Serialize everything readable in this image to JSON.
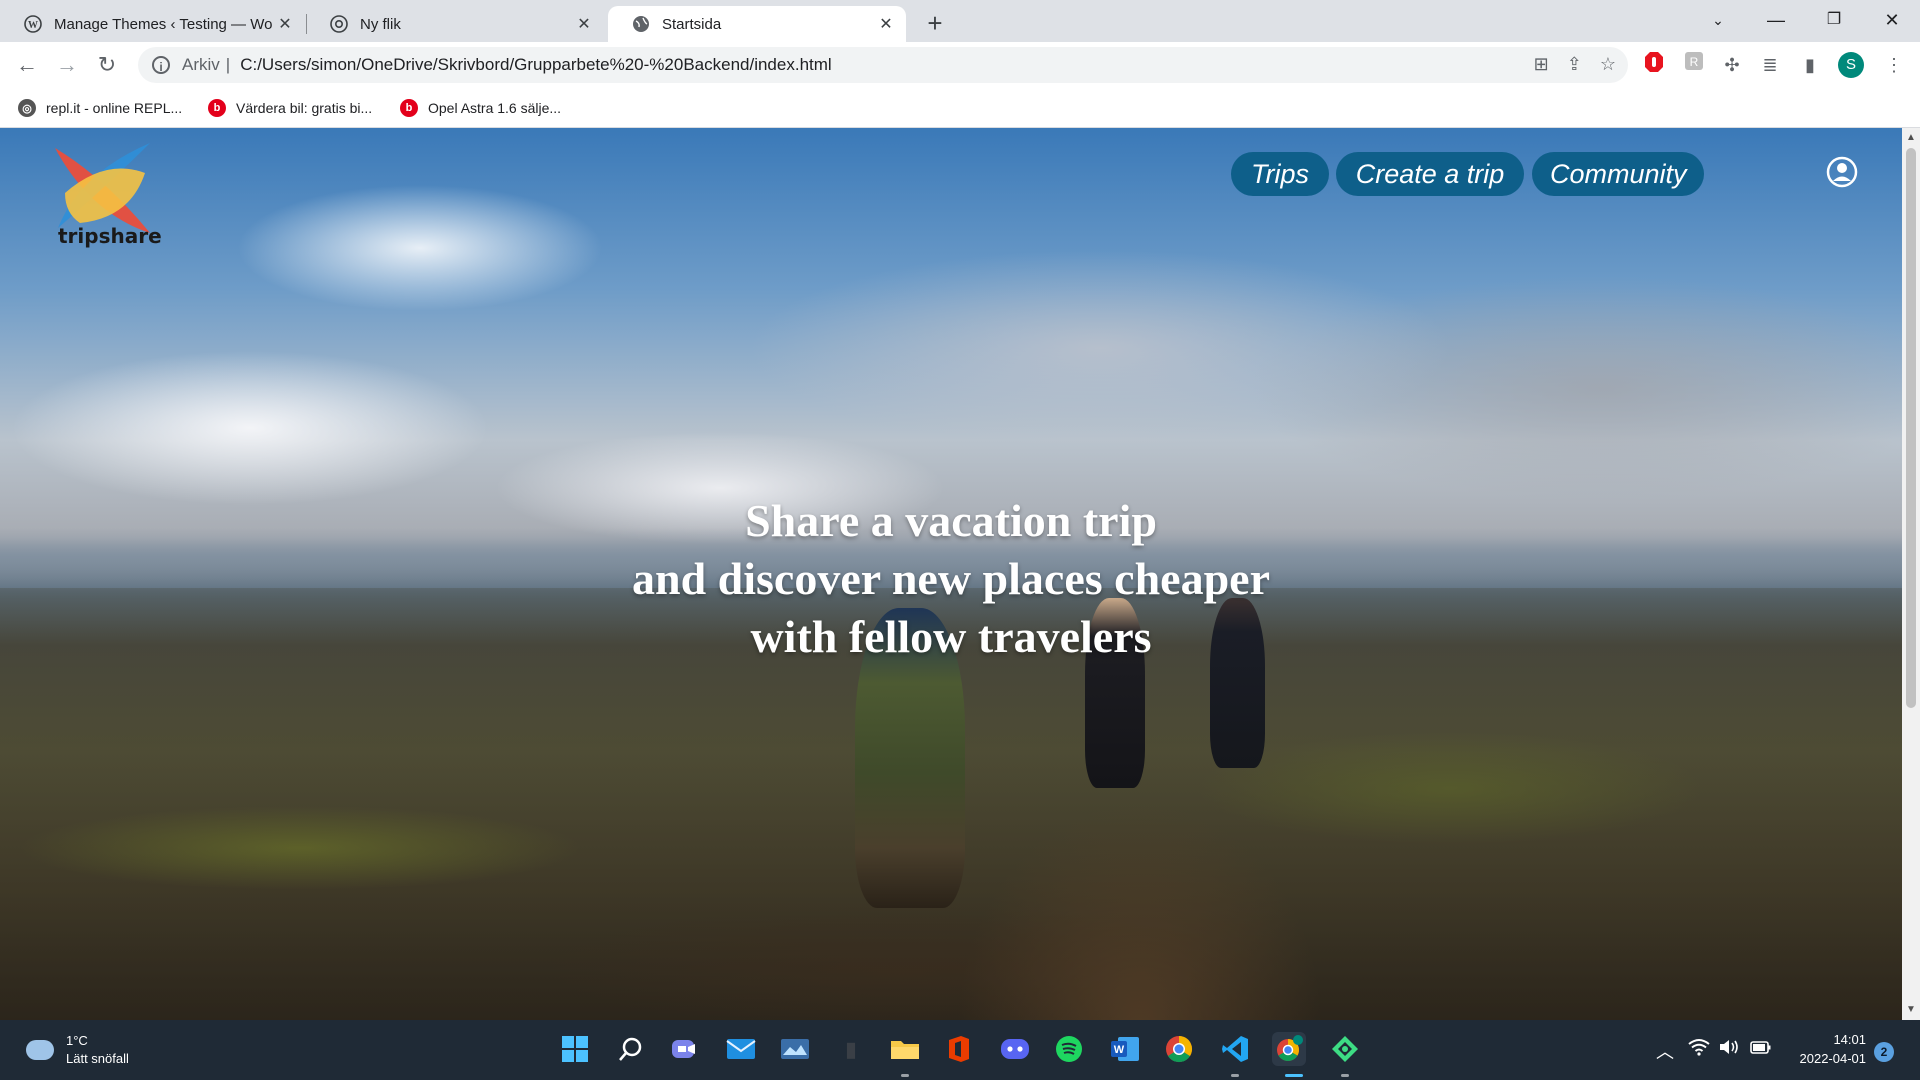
{
  "browser": {
    "tabs": [
      {
        "title": "Manage Themes ‹ Testing — Wo",
        "favicon": "wordpress-icon",
        "active": false
      },
      {
        "title": "Ny flik",
        "favicon": "chrome-icon",
        "active": false
      },
      {
        "title": "Startsida",
        "favicon": "globe-icon",
        "active": true
      }
    ],
    "address_prefix": "Arkiv",
    "address": "C:/Users/simon/OneDrive/Skrivbord/Grupparbete%20-%20Backend/index.html",
    "profile_initial": "S",
    "bookmarks": [
      {
        "label": "repl.it - online REPL...",
        "icon": "replit-icon",
        "color": "#555555"
      },
      {
        "label": "Värdera bil: gratis bi...",
        "icon": "blocket-icon",
        "color": "#e3001b"
      },
      {
        "label": "Opel Astra 1.6 sälje...",
        "icon": "blocket-icon",
        "color": "#e3001b"
      }
    ]
  },
  "site": {
    "logo_text": "tripshare",
    "nav": [
      {
        "label": "Trips"
      },
      {
        "label": "Create a trip"
      },
      {
        "label": "Community"
      }
    ],
    "nav_color": "#0e5f8a",
    "hero_lines": [
      "Share a vacation trip",
      "and discover new places cheaper",
      "with fellow travelers"
    ]
  },
  "taskbar": {
    "weather_temp": "1°C",
    "weather_desc": "Lätt snöfall",
    "time": "14:01",
    "date": "2022-04-01",
    "notification_count": "2",
    "apps": [
      "windows-start-icon",
      "search-icon",
      "teams-chat-icon",
      "mail-icon",
      "photos-icon",
      "file-explorer-icon",
      "folder-icon",
      "office-icon",
      "discord-icon",
      "spotify-icon",
      "word-icon",
      "chrome-icon",
      "vscode-icon",
      "chrome-profile-icon",
      "android-app-icon"
    ]
  }
}
